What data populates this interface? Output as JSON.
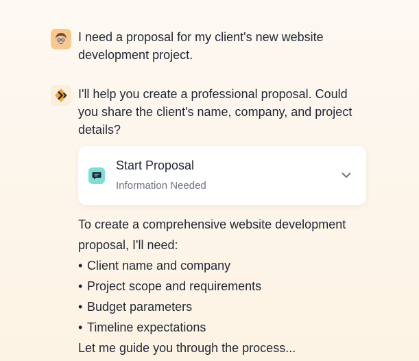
{
  "conversation": {
    "user_message": {
      "avatar_icon": "person-avatar-icon",
      "text": "I need a proposal for my client's new website development project."
    },
    "assistant_message": {
      "avatar_icon": "assistant-logo-icon",
      "text": "I'll help you create a professional proposal. Could you share the client's name, company, and project details?"
    },
    "tool_card": {
      "icon": "chat-bubble-icon",
      "title": "Start Proposal",
      "subtitle": "Information Needed",
      "toggle_icon": "chevron-down-icon"
    },
    "details": {
      "intro_line1": "To create a comprehensive website development",
      "intro_line2": "proposal, I'll need:",
      "bullet_symbol": "•",
      "items": [
        "Client name and company",
        "Project scope and requirements",
        "Budget parameters",
        "Timeline expectations"
      ],
      "closing": "Let me guide you through the process..."
    }
  },
  "colors": {
    "background": "#fdf6ec",
    "text": "#1f2633",
    "muted": "#6b7280",
    "user_avatar_bg": "#f7c98d",
    "card_icon_bg": "#7fdcd6"
  }
}
